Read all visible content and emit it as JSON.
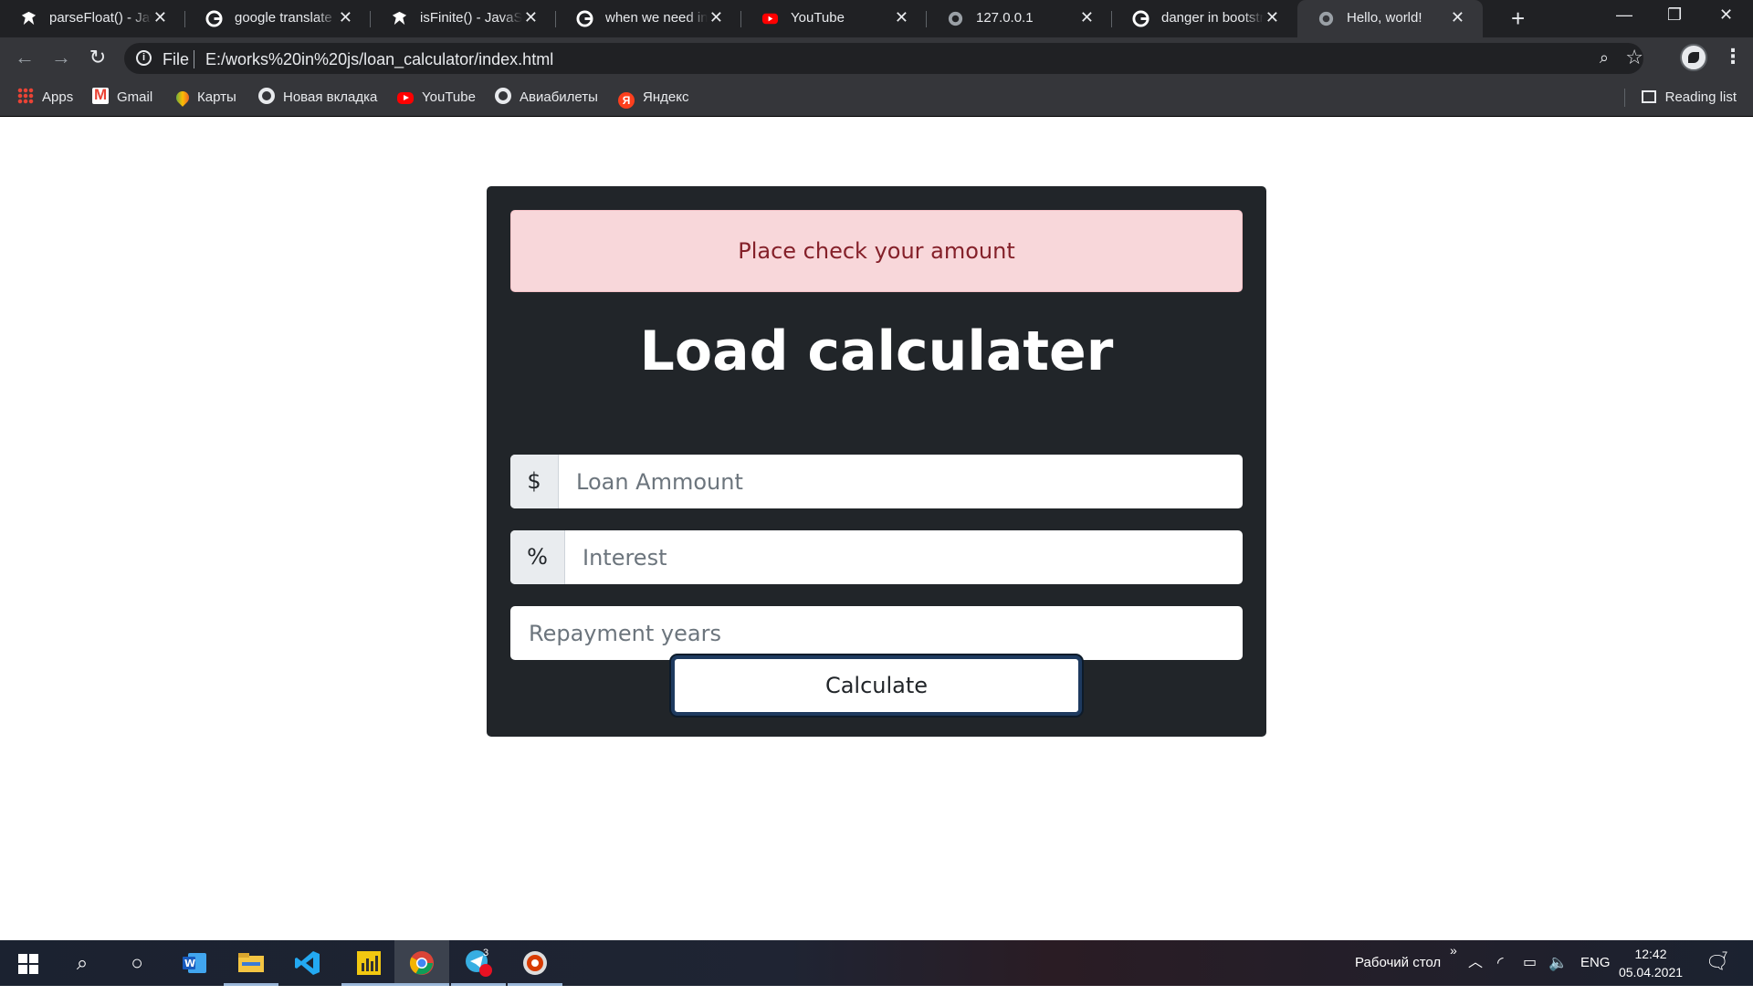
{
  "browser": {
    "tabs": [
      {
        "title": "parseFloat() - JavaScript",
        "icon": "mdn-icon"
      },
      {
        "title": "google translate - Google",
        "icon": "google-icon"
      },
      {
        "title": "isFinite() - JavaScript",
        "icon": "mdn-icon"
      },
      {
        "title": "when we need inFinite",
        "icon": "google-icon"
      },
      {
        "title": "YouTube",
        "icon": "youtube-icon"
      },
      {
        "title": "127.0.0.1",
        "icon": "globe-icon"
      },
      {
        "title": "danger in bootstrap",
        "icon": "google-icon"
      },
      {
        "title": "Hello, world!",
        "icon": "globe-icon",
        "active": true
      }
    ],
    "address": {
      "scheme": "File",
      "url": "E:/works%20in%20js/loan_calculator/index.html"
    },
    "bookmarks": [
      "Apps",
      "Gmail",
      "Карты",
      "Новая вкладка",
      "YouTube",
      "Авиабилеты",
      "Яндекс"
    ],
    "reading_list": "Reading list"
  },
  "page": {
    "alert": "Place check your amount",
    "heading": "Load calculater",
    "amount": {
      "addon": "$",
      "placeholder": "Loan Ammount"
    },
    "interest": {
      "addon": "%",
      "placeholder": "Interest"
    },
    "years": {
      "placeholder": "Repayment years"
    },
    "button": "Calculate",
    "colors": {
      "card": "#212529",
      "alert_bg": "#f8d7da",
      "alert_text": "#842029"
    }
  },
  "taskbar": {
    "apps": [
      "search-icon",
      "cortana-icon",
      "word-icon",
      "file-explorer-icon",
      "vscode-icon",
      "powerbi-icon",
      "chrome-icon",
      "telegram-icon",
      "media-icon"
    ],
    "telegram_badge": "3",
    "desktop_label": "Рабочий стол",
    "chevron": "»",
    "language": "ENG",
    "time": "12:42",
    "date": "05.04.2021",
    "notifications": "7"
  }
}
